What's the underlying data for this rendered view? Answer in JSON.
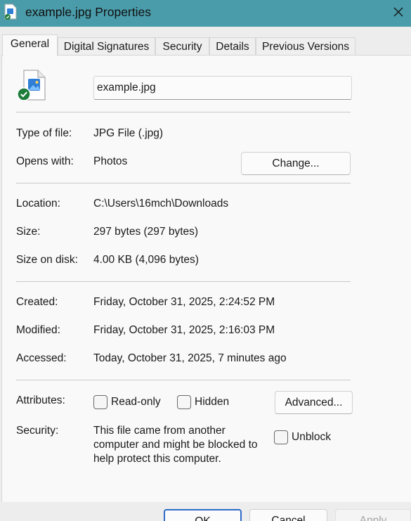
{
  "window": {
    "title": "example.jpg Properties",
    "close_icon": "close-icon",
    "app_icon": "file-properties-icon"
  },
  "tabs": [
    {
      "label": "General",
      "active": true
    },
    {
      "label": "Digital Signatures",
      "active": false
    },
    {
      "label": "Security",
      "active": false
    },
    {
      "label": "Details",
      "active": false
    },
    {
      "label": "Previous Versions",
      "active": false
    }
  ],
  "general": {
    "file_icon": "image-file-icon",
    "filename": "example.jpg",
    "type_label": "Type of file:",
    "type_value": "JPG File (.jpg)",
    "opens_label": "Opens with:",
    "opens_value": "Photos",
    "change_button": "Change...",
    "location_label": "Location:",
    "location_value": "C:\\Users\\16mch\\Downloads",
    "size_label": "Size:",
    "size_value": "297 bytes (297 bytes)",
    "size_disk_label": "Size on disk:",
    "size_disk_value": "4.00 KB (4,096 bytes)",
    "created_label": "Created:",
    "created_value": "Friday, October 31, 2025, 2:24:52 PM",
    "modified_label": "Modified:",
    "modified_value": "Friday, October 31, 2025, 2:16:03 PM",
    "accessed_label": "Accessed:",
    "accessed_value": "Today, October 31, 2025, 7 minutes ago",
    "attributes_label": "Attributes:",
    "readonly_label": "Read-only",
    "readonly_checked": false,
    "hidden_label": "Hidden",
    "hidden_checked": false,
    "advanced_button": "Advanced...",
    "security_label": "Security:",
    "security_text": "This file came from another computer and might be blocked to help protect this computer.",
    "unblock_label": "Unblock",
    "unblock_checked": false
  },
  "footer": {
    "ok": "OK",
    "cancel": "Cancel",
    "apply": "Apply"
  },
  "colors": {
    "titlebar": "#4a9caa",
    "ok_border": "#2d6bc8",
    "badge_green": "#1e7c3a"
  }
}
